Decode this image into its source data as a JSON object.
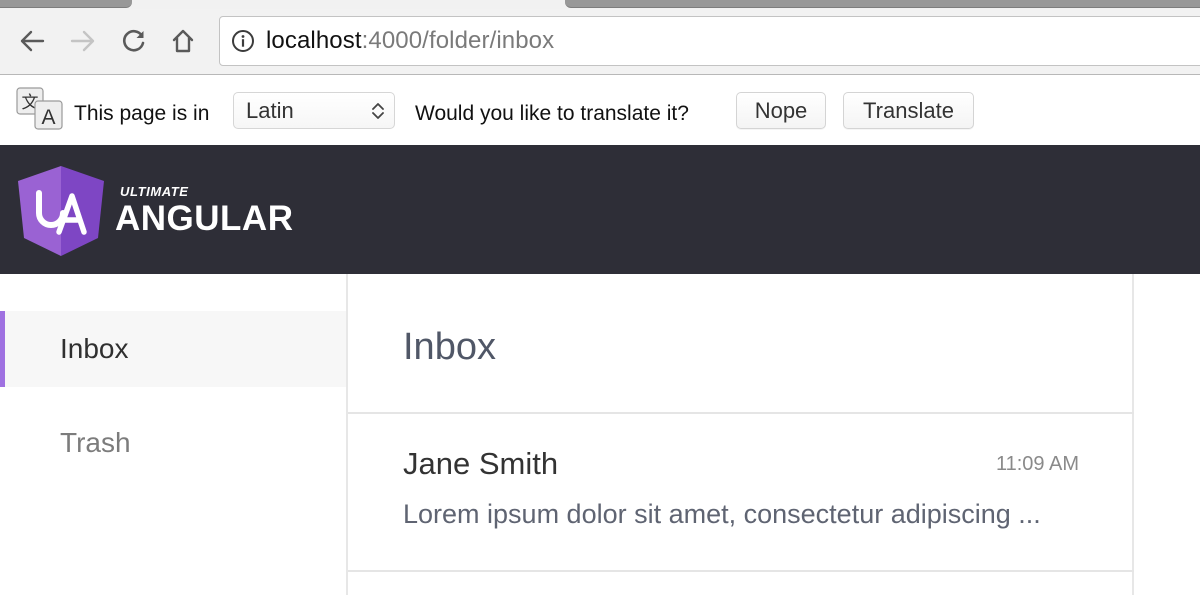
{
  "browser": {
    "nav": {
      "back_icon": "arrow-left-icon",
      "forward_icon": "arrow-right-icon",
      "reload_icon": "reload-icon",
      "home_icon": "home-icon"
    },
    "omnibox": {
      "info_icon": "info-circle-icon",
      "url_host": "localhost",
      "url_path": ":4000/folder/inbox"
    }
  },
  "translate_bar": {
    "icon": "translate-icon",
    "prefix_text": "This page is in",
    "language_selected": "Latin",
    "question_text": "Would you like to translate it?",
    "nope_label": "Nope",
    "translate_label": "Translate"
  },
  "header": {
    "logo_monogram": "UA",
    "brand_small": "ULTIMATE",
    "brand_big": "ANGULAR",
    "colors": {
      "background": "#2e2e37",
      "shield_light": "#9a62d3",
      "shield_dark": "#7e46c4"
    }
  },
  "sidebar": {
    "accent_color": "#9f71e1",
    "items": [
      {
        "label": "Inbox",
        "active": true
      },
      {
        "label": "Trash",
        "active": false
      }
    ]
  },
  "main": {
    "title": "Inbox",
    "messages": [
      {
        "from": "Jane Smith",
        "time": "11:09 AM",
        "preview": "Lorem ipsum dolor sit amet, consectetur adipiscing ..."
      }
    ]
  }
}
